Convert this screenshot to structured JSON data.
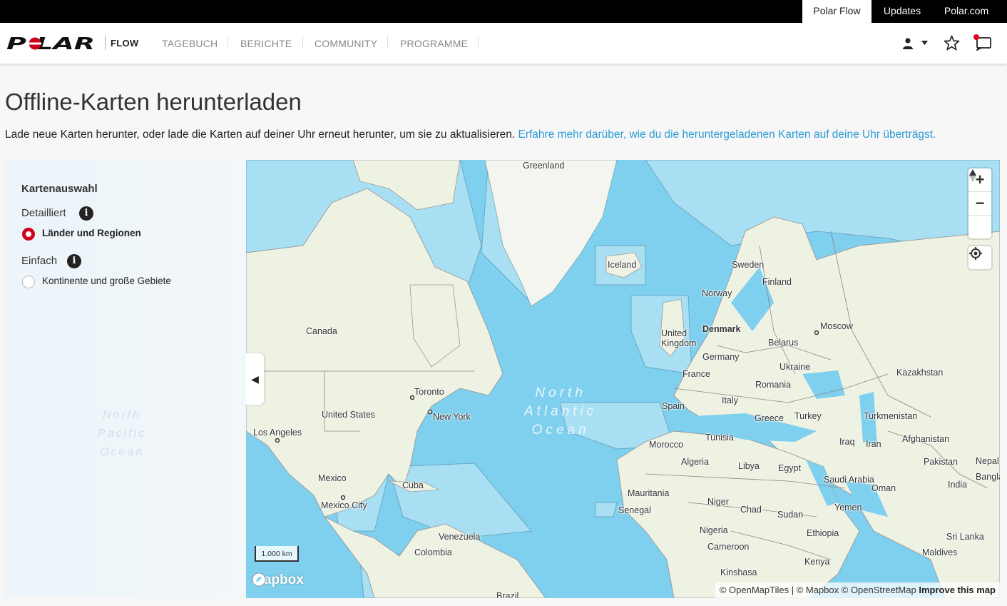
{
  "topbar": {
    "links": [
      "Polar Flow",
      "Updates",
      "Polar.com"
    ]
  },
  "nav": {
    "brand": "POLAR",
    "product": "FLOW",
    "items": [
      "TAGEBUCH",
      "BERICHTE",
      "COMMUNITY",
      "PROGRAMME"
    ],
    "icons": [
      "user-icon",
      "chevron-down-icon",
      "star-icon",
      "notifications-icon"
    ],
    "accent": "#d0021b"
  },
  "page": {
    "title": "Offline-Karten herunterladen",
    "description": "Lade neue Karten herunter, oder lade die Karten auf deiner Uhr erneut herunter, um sie zu aktualisieren.",
    "learn_more": "Erfahre mehr darüber, wie du die heruntergeladenen Karten auf deine Uhr überträgst."
  },
  "panel": {
    "heading": "Kartenauswahl",
    "detailed_label": "Detailliert",
    "detailed_option": "Länder und Regionen",
    "simple_label": "Einfach",
    "simple_option": "Kontinente und große Gebiete",
    "selected": "Länder und Regionen",
    "ghost_text": "North\nPacific\nOcean"
  },
  "map": {
    "ocean_label": "North\nAtlantic\nOcean",
    "labels": {
      "greenland": "Greenland",
      "iceland": "Iceland",
      "canada": "Canada",
      "toronto": "Toronto",
      "new_york": "New York",
      "united_states": "United States",
      "los_angeles": "Los Angeles",
      "mexico": "Mexico",
      "mexico_city": "Mexico City",
      "cuba": "Cuba",
      "venezuela": "Venezuela",
      "colombia": "Colombia",
      "brazil": "Brazil",
      "sweden": "Sweden",
      "finland": "Finland",
      "norway": "Norway",
      "united_kingdom": "United\nKingdom",
      "denmark": "Denmark",
      "moscow": "Moscow",
      "belarus": "Belarus",
      "germany": "Germany",
      "ukraine": "Ukraine",
      "france": "France",
      "kazakhstan": "Kazakhstan",
      "romania": "Romania",
      "italy": "Italy",
      "spain": "Spain",
      "greece": "Greece",
      "turkey": "Turkey",
      "turkmenistan": "Turkmenistan",
      "tunisia": "Tunisia",
      "iraq": "Iraq",
      "iran": "Iran",
      "afghanistan": "Afghanistan",
      "morocco": "Morocco",
      "pakistan": "Pakistan",
      "algeria": "Algeria",
      "libya": "Libya",
      "egypt": "Egypt",
      "saudi_arabia": "Saudi Arabia",
      "nepal": "Nepal",
      "bangladesh": "Bangla",
      "india": "India",
      "oman": "Oman",
      "mauritania": "Mauritania",
      "niger": "Niger",
      "yemen": "Yemen",
      "senegal": "Senegal",
      "chad": "Chad",
      "sudan": "Sudan",
      "nigeria": "Nigeria",
      "ethiopia": "Ethiopia",
      "sri_lanka": "Sri Lanka",
      "cameroon": "Cameroon",
      "maldives": "Maldives",
      "kenya": "Kenya",
      "kinshasa": "Kinshasa"
    },
    "scale": "1.000 km",
    "mapbox_logo": "mapbox",
    "attribution": "© OpenMapTiles | © Mapbox © OpenStreetMap",
    "improve": "Improve this map",
    "colors": {
      "water": "#7fcfee",
      "land": "#eef2e3",
      "shelf": "#a9dff3"
    }
  }
}
